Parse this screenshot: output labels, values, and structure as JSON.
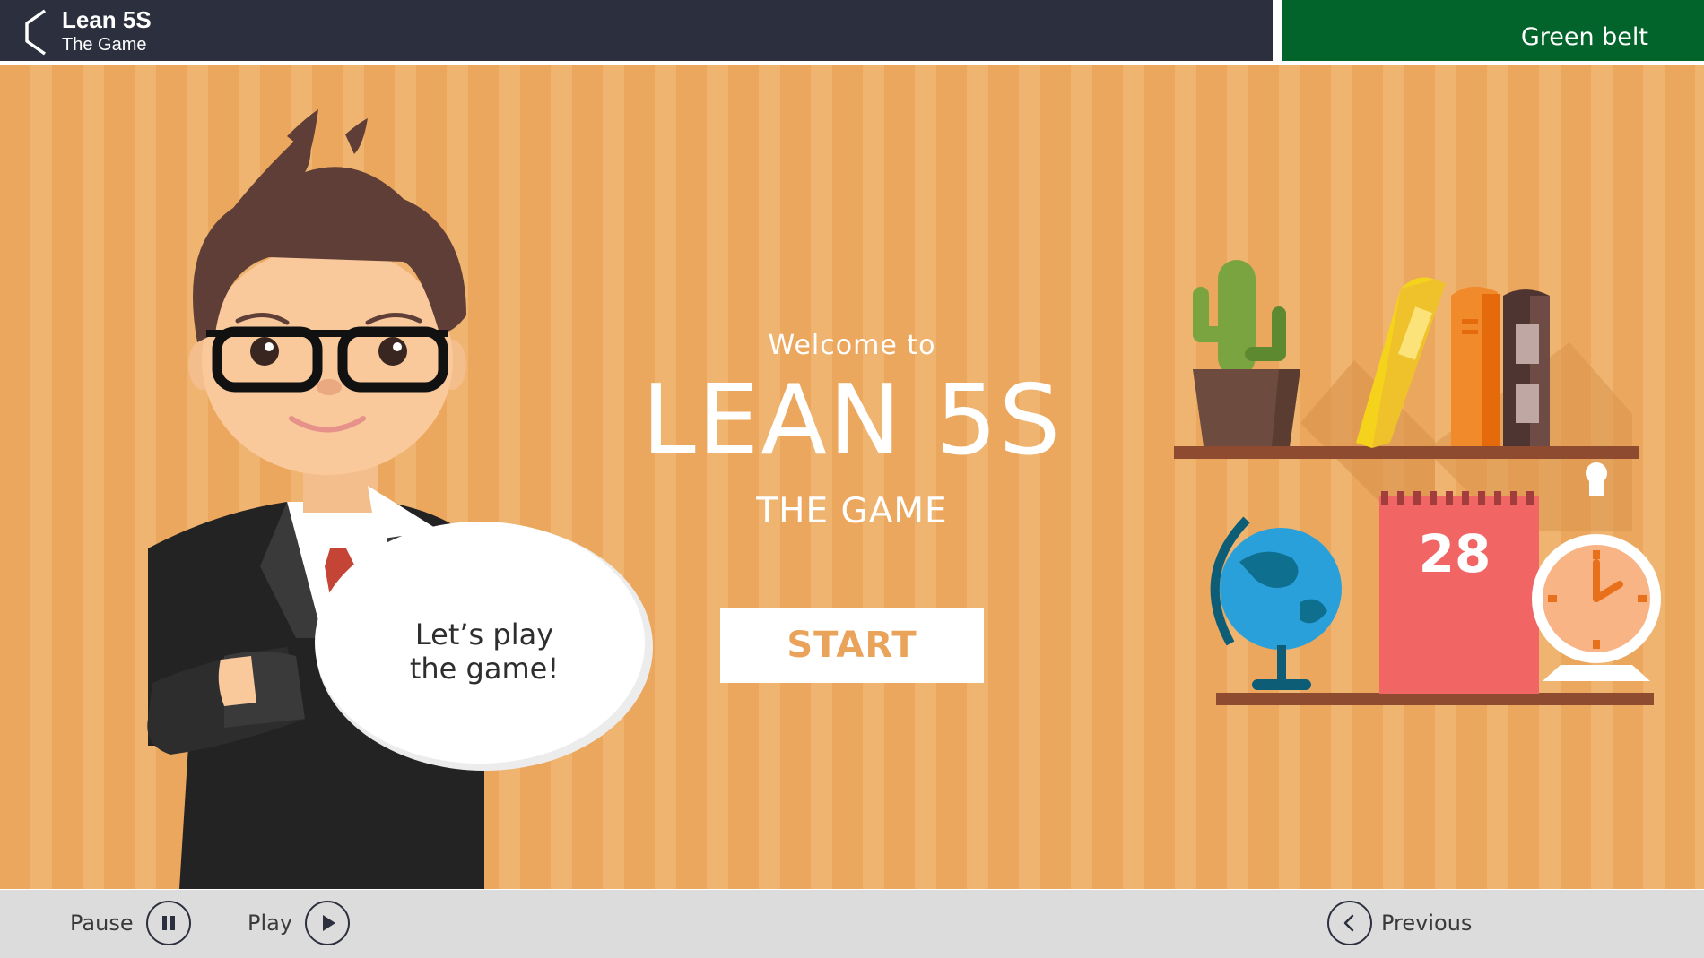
{
  "header": {
    "title": "Lean 5S",
    "subtitle": "The Game",
    "back_icon": "chevron-left-icon",
    "level_badge": "Green belt",
    "bar_color": "#2c2f3e",
    "badge_color": "#02642a"
  },
  "stage": {
    "welcome": "Welcome to",
    "title": "LEAN 5S",
    "subtitle": "THE GAME",
    "start_label": "START",
    "speech_line1": "Let’s play",
    "speech_line2": "the game!",
    "calendar_day": "28",
    "background_color": "#eca75e",
    "accent_color": "#e9a35a"
  },
  "controls": {
    "pause_label": "Pause",
    "pause_icon": "pause-icon",
    "play_label": "Play",
    "play_icon": "play-icon",
    "previous_label": "Previous",
    "previous_icon": "chevron-left-icon"
  }
}
